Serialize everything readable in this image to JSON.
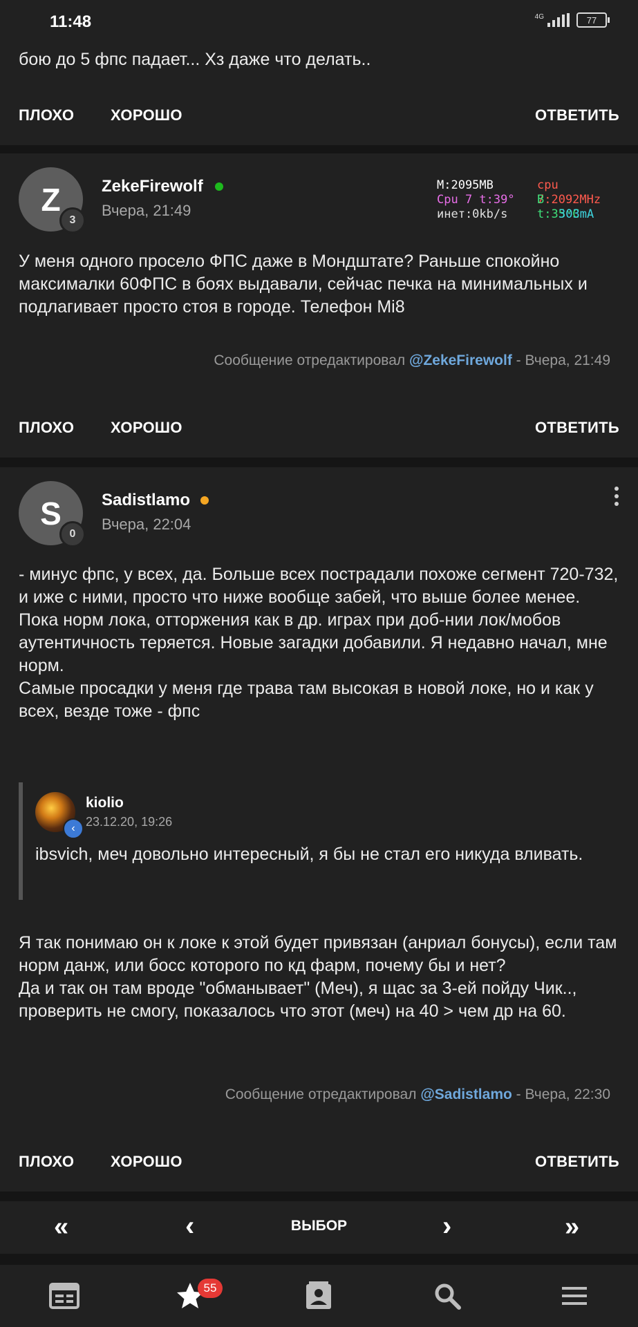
{
  "status_bar": {
    "time": "11:48",
    "network": "4G",
    "battery": "77"
  },
  "top_card": {
    "text": "бою до 5 фпс падает... Хз даже что делать..",
    "bad": "ПЛОХО",
    "good": "ХОРОШО",
    "reply": "ОТВЕТИТЬ"
  },
  "post1": {
    "avatar_letter": "Z",
    "rank": "3",
    "username": "ZekeFirewolf",
    "online_color": "#1db91d",
    "time": "Вчера, 21:49",
    "overlay": {
      "mem": "M:2095MB",
      "cpu": "cpu 7:2092MHz",
      "cpu_temp": "Cpu 7 t:39°",
      "bat_temp": "B t:35°C",
      "net": "инет:0kb/s",
      "current": "303mA"
    },
    "text": "У меня одного просело ФПС даже в Мондштате? Раньше спокойно максималки 60ФПС в боях выдавали, сейчас печка на минимальных и подлагивает просто стоя в городе. Телефон Mi8",
    "edited_prefix": "Сообщение отредактировал ",
    "edited_user": "@ZekeFirewolf",
    "edited_suffix": " - Вчера, 21:49",
    "bad": "ПЛОХО",
    "good": "ХОРОШО",
    "reply": "ОТВЕТИТЬ"
  },
  "post2": {
    "avatar_letter": "S",
    "rank": "0",
    "username": "Sadistlamo",
    "online_color": "#f5a623",
    "time": "Вчера, 22:04",
    "text_lines": [
      "- минус фпс, у всех, да. Больше всех пострадали похоже сегмент 720-732, и иже с ними, просто что ниже вообще забей, что выше более менее.",
      "Пока норм лока, отторжения как в др. играх при доб-нии лок/мобов аутентичность теряется. Новые загадки добавили. Я недавно начал, мне норм.",
      "Самые просадки у меня где трава там высокая в новой локе, но и как у всех, везде тоже - фпс"
    ],
    "quote": {
      "author": "kiolio",
      "date": "23.12.20, 19:26",
      "text": "ibsvich, меч довольно интересный, я бы не стал его никуда вливать."
    },
    "text2_lines": [
      "Я так понимаю он к локе к этой будет привязан (анриал бонусы), если там норм данж, или босс которого по кд фарм, почему бы и нет?",
      "Да и так он там вроде \"обманывает\" (Меч), я щас за 3-ей пойду Чик.., проверить не смогу, показалось что этот (меч) на 40 > чем др на 60."
    ],
    "edited_prefix": "Сообщение отредактировал ",
    "edited_user": "@Sadistlamo",
    "edited_suffix": " - Вчера, 22:30",
    "bad": "ПЛОХО",
    "good": "ХОРОШО",
    "reply": "ОТВЕТИТЬ"
  },
  "pager": {
    "first": "«",
    "prev": "‹",
    "select": "ВЫБОР",
    "next": "›",
    "last": "»"
  },
  "tabbar": {
    "items": [
      "news-icon",
      "star-icon",
      "contacts-icon",
      "search-icon",
      "menu-icon"
    ],
    "favorites_badge": "55"
  }
}
